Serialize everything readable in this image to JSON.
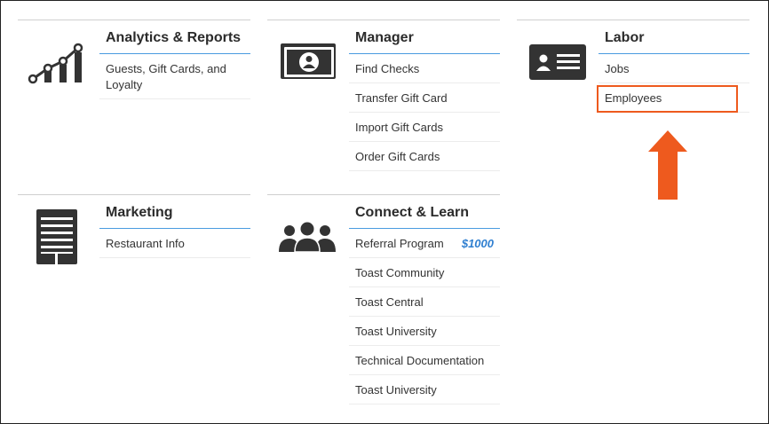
{
  "colors": {
    "accent_blue": "#4a9be0",
    "highlight_orange": "#ee5a1e",
    "badge_blue": "#2f7fd0",
    "icon_dark": "#333333"
  },
  "sections": {
    "analytics": {
      "title": "Analytics & Reports",
      "icon": "trend-chart-icon",
      "items": [
        "Guests, Gift Cards, and Loyalty"
      ]
    },
    "manager": {
      "title": "Manager",
      "icon": "cash-bill-icon",
      "items": [
        "Find Checks",
        "Transfer Gift Card",
        "Import Gift Cards",
        "Order Gift Cards"
      ]
    },
    "labor": {
      "title": "Labor",
      "icon": "id-card-icon",
      "items": [
        "Jobs",
        "Employees"
      ]
    },
    "marketing": {
      "title": "Marketing",
      "icon": "building-icon",
      "items": [
        "Restaurant Info"
      ]
    },
    "connect": {
      "title": "Connect & Learn",
      "icon": "people-group-icon",
      "items": [
        "Referral Program",
        "Toast Community",
        "Toast Central",
        "Toast University",
        "Technical Documentation",
        "Toast University"
      ],
      "referral_badge": "$1000"
    }
  }
}
